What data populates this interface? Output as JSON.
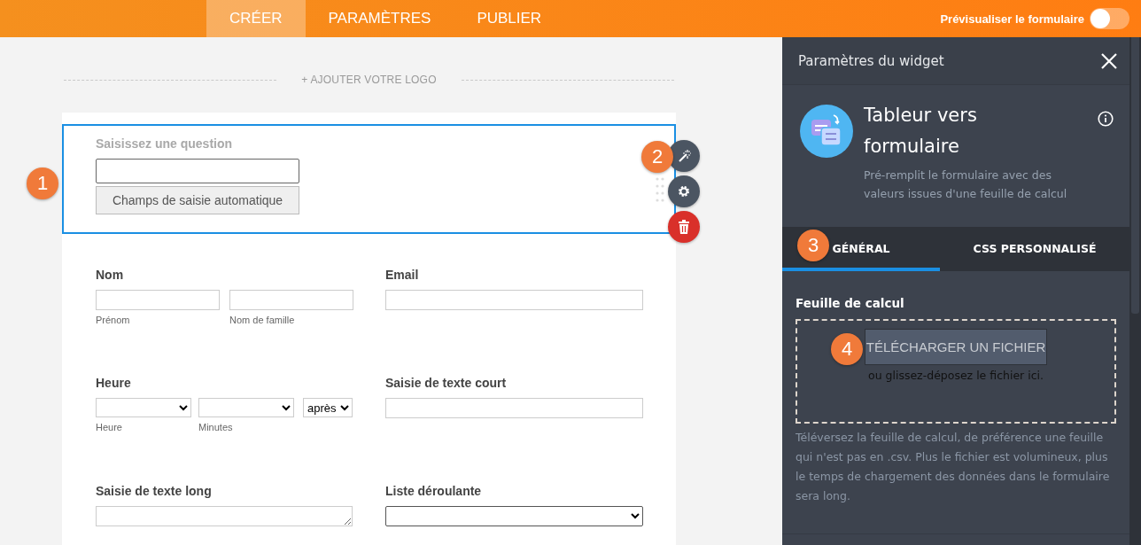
{
  "top_nav": {
    "tabs": [
      {
        "label": "CRÉER",
        "selected": true
      },
      {
        "label": "PARAMÈTRES",
        "selected": false
      },
      {
        "label": "PUBLIER",
        "selected": false
      }
    ],
    "preview_toggle": {
      "label": "Prévisualiser le formulaire",
      "on": false
    }
  },
  "form": {
    "add_logo": "+ AJOUTER VOTRE LOGO",
    "selected_widget": {
      "question_hint": "Saisissez une question",
      "autofill_button": "Champs de saisie automatique"
    },
    "rows": [
      [
        {
          "kind": "name",
          "label": "Nom",
          "sublabels": [
            "Prénom",
            "Nom de famille"
          ]
        },
        {
          "kind": "text",
          "label": "Email"
        }
      ],
      [
        {
          "kind": "time",
          "label": "Heure",
          "sublabels": [
            "Heure",
            "Minutes"
          ],
          "period": "après"
        },
        {
          "kind": "text",
          "label": "Saisie de texte court"
        }
      ],
      [
        {
          "kind": "textarea",
          "label": "Saisie de texte long"
        },
        {
          "kind": "dropdown",
          "label": "Liste déroulante"
        }
      ]
    ]
  },
  "widget_panel": {
    "title": "Paramètres du widget",
    "widget_name": "Tableur vers formulaire",
    "widget_description": "Pré-remplit le formulaire avec des valeurs issues d'une feuille de calcul",
    "tabs": [
      {
        "label": "GÉNÉRAL",
        "selected": true
      },
      {
        "label": "CSS PERSONNALISÉ",
        "selected": false
      }
    ],
    "section_title": "Feuille de calcul",
    "upload_button": "TÉLÉCHARGER UN FICHIER",
    "drop_hint": "ou glissez-déposez le fichier ici.",
    "help_text": "Téléversez la feuille de calcul, de préférence une feuille qui n'est pas en .csv. Plus le fichier est volumineux, plus le temps de chargement des données dans le formulaire sera long."
  },
  "callouts": [
    "1",
    "2",
    "3",
    "4"
  ]
}
